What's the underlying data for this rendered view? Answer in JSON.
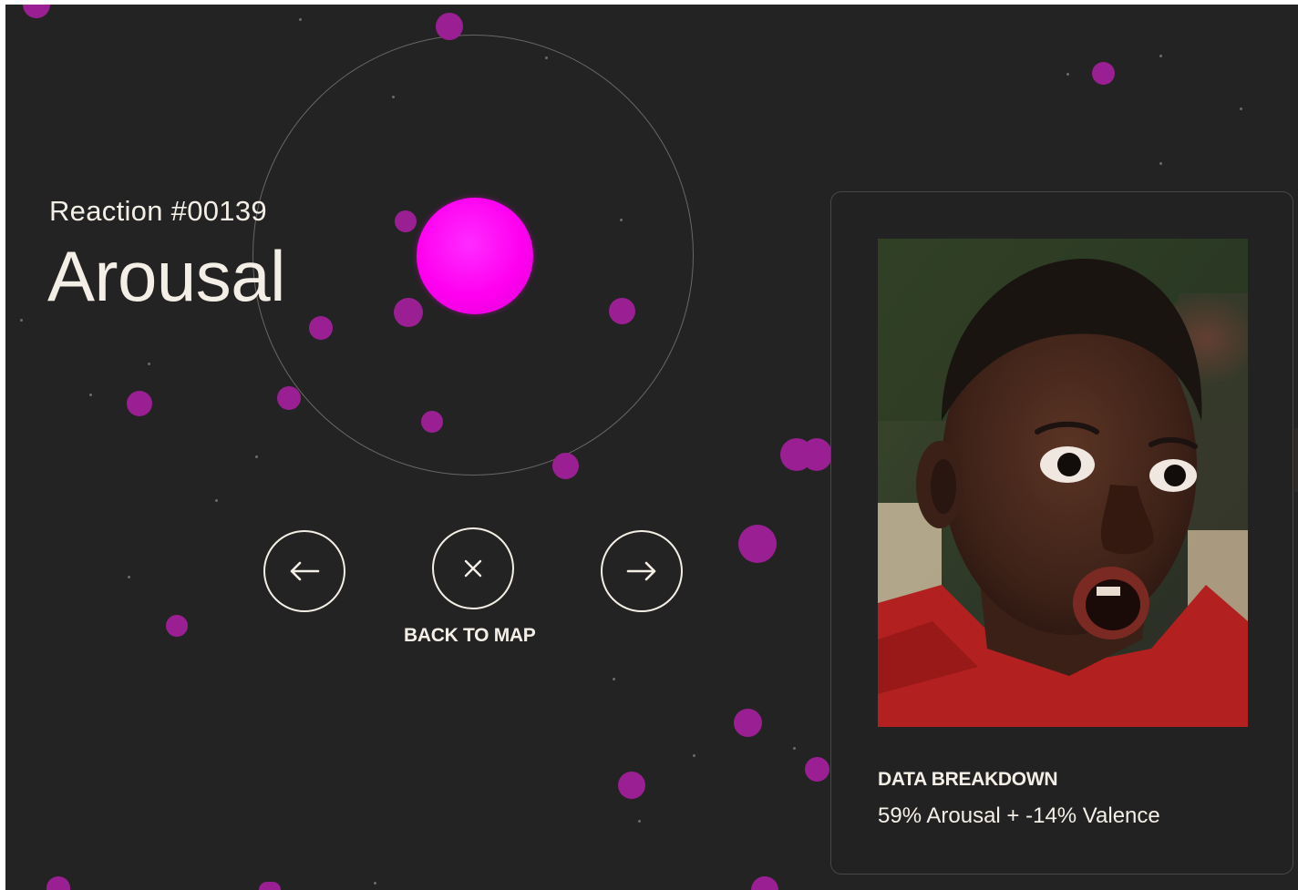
{
  "reaction": {
    "id_label": "Reaction #00139",
    "emotion": "Arousal"
  },
  "navigation": {
    "prev_icon": "arrow-left-icon",
    "close_icon": "close-icon",
    "next_icon": "arrow-right-icon",
    "back_label": "BACK TO MAP"
  },
  "panel": {
    "heading": "DATA BREAKDOWN",
    "breakdown": "59% Arousal + -14% Valence"
  },
  "colors": {
    "background": "#242323",
    "text": "#f4efe6",
    "accent_orb": "#ff00f0",
    "dot": "#9a1f93"
  }
}
